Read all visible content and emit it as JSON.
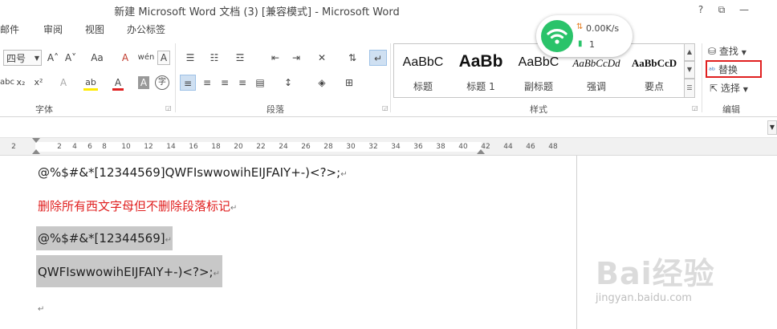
{
  "window": {
    "title": "新建 Microsoft Word 文档 (3) [兼容模式] - Microsoft Word"
  },
  "window_controls": {
    "help": "?",
    "restore": "⧉",
    "minimize": "—"
  },
  "tabs": [
    "邮件",
    "审阅",
    "视图",
    "办公标签"
  ],
  "ribbon": {
    "font": {
      "size": "四号",
      "grow": "A˄",
      "shrink": "A˅",
      "case": "Aa",
      "clear": "A",
      "pinyin": "wén",
      "border_a": "A",
      "sub": "x₂",
      "sup": "x²",
      "effect_a": "A",
      "highlight": "ab",
      "color_a": "A",
      "shade_a": "A",
      "enclose": "字",
      "label": "字体"
    },
    "paragraph": {
      "label": "段落"
    },
    "styles": {
      "label": "样式",
      "items": [
        {
          "sample": "AaBbC",
          "name": "标题"
        },
        {
          "sample": "AaBb",
          "name": "标题 1"
        },
        {
          "sample": "AaBbC",
          "name": "副标题"
        },
        {
          "sample": "AaBbCcDd",
          "name": "强调"
        },
        {
          "sample": "AaBbCcD",
          "name": "要点"
        }
      ]
    },
    "editing": {
      "find": "查找",
      "replace": "替换",
      "select": "选择",
      "label": "编辑"
    }
  },
  "wifi_widget": {
    "speed": "0.00K/s",
    "count": "1"
  },
  "ruler": {
    "marks": [
      "2",
      "2",
      "4",
      "6",
      "8",
      "10",
      "12",
      "14",
      "16",
      "18",
      "20",
      "22",
      "24",
      "26",
      "28",
      "30",
      "32",
      "34",
      "36",
      "38",
      "40",
      "42",
      "44",
      "46",
      "48"
    ]
  },
  "document": {
    "paragraphs": [
      "@%$#&*[12344569]QWFIswwowihEIJFAIY+-)<?>;",
      "删除所有西文字母但不删除段落标记",
      "@%$#&*[12344569]",
      "QWFIswwowihEIJFAIY+-)<?>;",
      ""
    ],
    "para_mark": "↵"
  },
  "watermark": {
    "brand": "Bai经验",
    "url": "jingyan.baidu.com"
  },
  "colors": {
    "highlight_box": "#e02020",
    "selection_bg": "#c8c8c8",
    "wifi_green": "#2ac36a",
    "red_text": "#e02020"
  }
}
